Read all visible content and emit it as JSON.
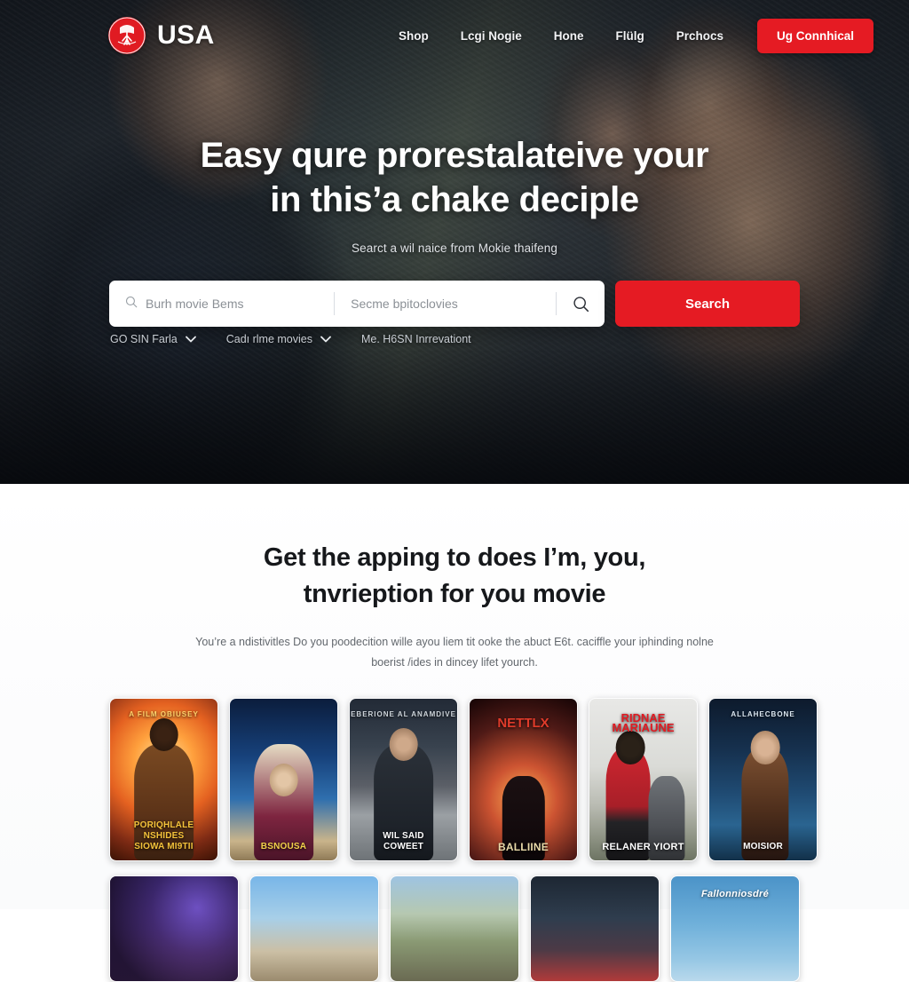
{
  "brand": {
    "name": "USA",
    "logo_icon": "usa-circle-logo",
    "accent_color": "#e51b23"
  },
  "nav": {
    "items": [
      {
        "label": "Shop"
      },
      {
        "label": "Lcgi Nogie"
      },
      {
        "label": "Hone"
      },
      {
        "label": "Flülg"
      },
      {
        "label": "Prchocs"
      }
    ],
    "cta_label": "Ug Connhical"
  },
  "hero": {
    "title_line1": "Easy qure prorestalateive your",
    "title_line2": "in this’a chake deciple",
    "subtitle": "Searct a wil naice from Mokie thaifeng"
  },
  "search": {
    "field1_placeholder": "Burh movie Bems",
    "field1_value": "",
    "field1_icon": "search-icon",
    "field2_placeholder": "Secme bpitoclovies",
    "field2_value": "",
    "magnifier_icon": "search-icon",
    "button_label": "Search"
  },
  "filters": [
    {
      "label": "GO SIN Farla",
      "has_caret": true
    },
    {
      "label": "Cadı rlme movies",
      "has_caret": true
    },
    {
      "label": "Me. H6SN Inrrevationt",
      "has_caret": false
    }
  ],
  "features": {
    "title_line1": "Get the apping to does I’m, you,",
    "title_line2": "tnvrieption for you movie",
    "description": "You’re a ndistivitles Do you poodecition wille ayou liem tit ooke the abuct E6t. caciffle your iphinding nolne boerist /ides in dincey lifet yourch."
  },
  "posters": [
    {
      "top_tag": "A FILM OBIUSEY",
      "caption": "PORIQHLALE NSHIDES\nSIOWA MI9TII",
      "caption_color": "#f4c23a",
      "art": "art-fire"
    },
    {
      "top_tag": "",
      "caption": "BSNOUSA",
      "caption_color": "#f2d24a",
      "art": "art-blue"
    },
    {
      "top_tag": "EBERIONE   AL ANAMDIVE",
      "caption": "WIL SAID\nCOWEET",
      "caption_color": "#ffffff",
      "art": "art-dusk"
    },
    {
      "top_tag": "NETTLX",
      "caption": "BALLIINE",
      "caption_color": "#e8d9a8",
      "art": "art-red"
    },
    {
      "top_tag": "RIDNAE MARIAUNE",
      "caption": "RELANER YIORT",
      "caption_color": "#ffffff",
      "art": "art-light"
    },
    {
      "top_tag": "ALLAHECBONE",
      "caption": "MOISIOR",
      "caption_color": "#ffffff",
      "art": "art-space"
    }
  ],
  "cards": [
    {
      "caption": "",
      "art": "c-neon"
    },
    {
      "caption": "",
      "art": "c-sky"
    },
    {
      "caption": "",
      "art": "c-crowd"
    },
    {
      "caption": "",
      "art": "c-city"
    },
    {
      "caption": "Fallonniosdré",
      "art": "c-blue"
    }
  ]
}
